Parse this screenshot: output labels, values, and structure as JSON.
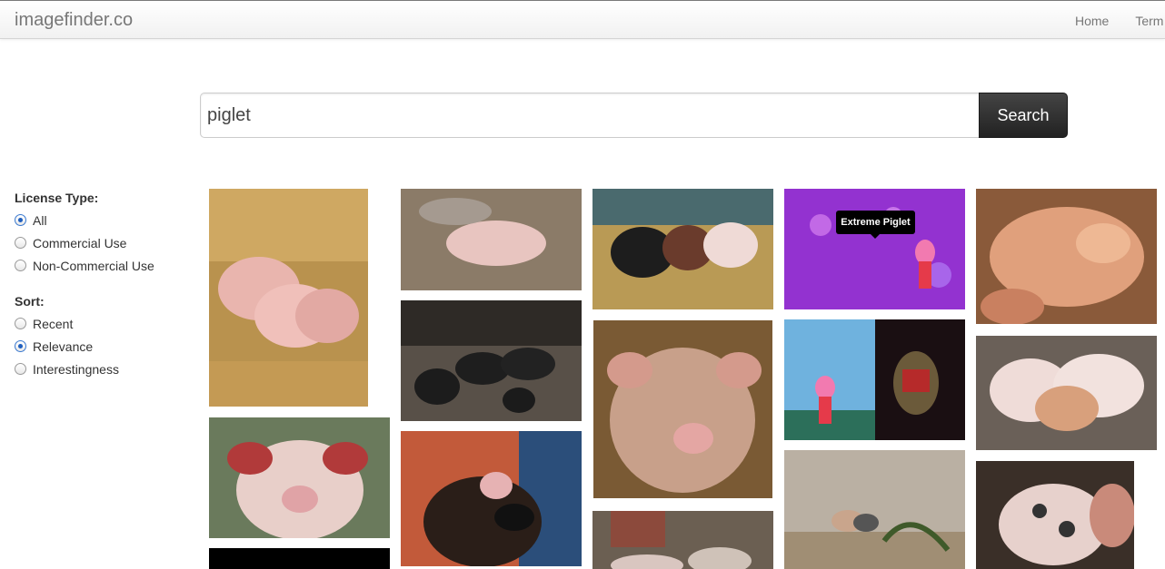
{
  "brand": "imagefinder.co",
  "nav": {
    "home": "Home",
    "terms": "Term"
  },
  "search": {
    "value": "piglet",
    "button_label": "Search"
  },
  "filters": {
    "license_title": "License Type:",
    "license_options": [
      {
        "label": "All",
        "checked": true
      },
      {
        "label": "Commercial Use",
        "checked": false
      },
      {
        "label": "Non-Commercial Use",
        "checked": false
      }
    ],
    "sort_title": "Sort:",
    "sort_options": [
      {
        "label": "Recent",
        "checked": false
      },
      {
        "label": "Relevance",
        "checked": true
      },
      {
        "label": "Interestingness",
        "checked": false
      }
    ]
  },
  "tooltip": "Extreme Piglet",
  "thumbnail_colors": {
    "straw": "#c9a15a",
    "dirt": "#8a7a66",
    "dark": "#2e2b28",
    "pink": "#e7b2ab",
    "purple": "#8a2fd0",
    "sky": "#6fb2de",
    "black": "#000000"
  }
}
